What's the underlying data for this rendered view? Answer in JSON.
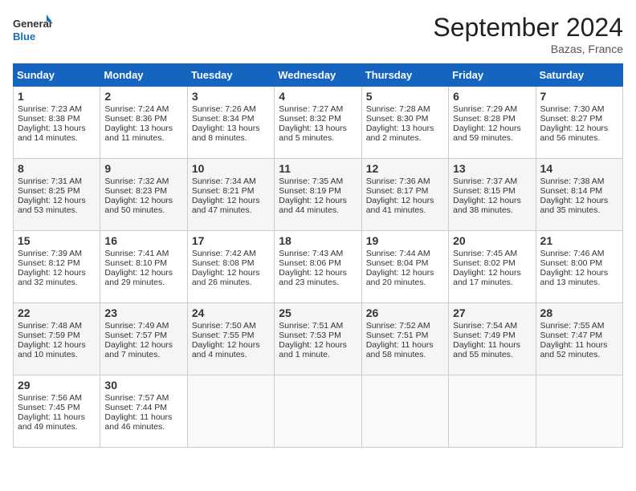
{
  "header": {
    "logo_line1": "General",
    "logo_line2": "Blue",
    "month": "September 2024",
    "location": "Bazas, France"
  },
  "weekdays": [
    "Sunday",
    "Monday",
    "Tuesday",
    "Wednesday",
    "Thursday",
    "Friday",
    "Saturday"
  ],
  "weeks": [
    [
      {
        "day": "1",
        "lines": [
          "Sunrise: 7:23 AM",
          "Sunset: 8:38 PM",
          "Daylight: 13 hours",
          "and 14 minutes."
        ]
      },
      {
        "day": "2",
        "lines": [
          "Sunrise: 7:24 AM",
          "Sunset: 8:36 PM",
          "Daylight: 13 hours",
          "and 11 minutes."
        ]
      },
      {
        "day": "3",
        "lines": [
          "Sunrise: 7:26 AM",
          "Sunset: 8:34 PM",
          "Daylight: 13 hours",
          "and 8 minutes."
        ]
      },
      {
        "day": "4",
        "lines": [
          "Sunrise: 7:27 AM",
          "Sunset: 8:32 PM",
          "Daylight: 13 hours",
          "and 5 minutes."
        ]
      },
      {
        "day": "5",
        "lines": [
          "Sunrise: 7:28 AM",
          "Sunset: 8:30 PM",
          "Daylight: 13 hours",
          "and 2 minutes."
        ]
      },
      {
        "day": "6",
        "lines": [
          "Sunrise: 7:29 AM",
          "Sunset: 8:28 PM",
          "Daylight: 12 hours",
          "and 59 minutes."
        ]
      },
      {
        "day": "7",
        "lines": [
          "Sunrise: 7:30 AM",
          "Sunset: 8:27 PM",
          "Daylight: 12 hours",
          "and 56 minutes."
        ]
      }
    ],
    [
      {
        "day": "8",
        "lines": [
          "Sunrise: 7:31 AM",
          "Sunset: 8:25 PM",
          "Daylight: 12 hours",
          "and 53 minutes."
        ]
      },
      {
        "day": "9",
        "lines": [
          "Sunrise: 7:32 AM",
          "Sunset: 8:23 PM",
          "Daylight: 12 hours",
          "and 50 minutes."
        ]
      },
      {
        "day": "10",
        "lines": [
          "Sunrise: 7:34 AM",
          "Sunset: 8:21 PM",
          "Daylight: 12 hours",
          "and 47 minutes."
        ]
      },
      {
        "day": "11",
        "lines": [
          "Sunrise: 7:35 AM",
          "Sunset: 8:19 PM",
          "Daylight: 12 hours",
          "and 44 minutes."
        ]
      },
      {
        "day": "12",
        "lines": [
          "Sunrise: 7:36 AM",
          "Sunset: 8:17 PM",
          "Daylight: 12 hours",
          "and 41 minutes."
        ]
      },
      {
        "day": "13",
        "lines": [
          "Sunrise: 7:37 AM",
          "Sunset: 8:15 PM",
          "Daylight: 12 hours",
          "and 38 minutes."
        ]
      },
      {
        "day": "14",
        "lines": [
          "Sunrise: 7:38 AM",
          "Sunset: 8:14 PM",
          "Daylight: 12 hours",
          "and 35 minutes."
        ]
      }
    ],
    [
      {
        "day": "15",
        "lines": [
          "Sunrise: 7:39 AM",
          "Sunset: 8:12 PM",
          "Daylight: 12 hours",
          "and 32 minutes."
        ]
      },
      {
        "day": "16",
        "lines": [
          "Sunrise: 7:41 AM",
          "Sunset: 8:10 PM",
          "Daylight: 12 hours",
          "and 29 minutes."
        ]
      },
      {
        "day": "17",
        "lines": [
          "Sunrise: 7:42 AM",
          "Sunset: 8:08 PM",
          "Daylight: 12 hours",
          "and 26 minutes."
        ]
      },
      {
        "day": "18",
        "lines": [
          "Sunrise: 7:43 AM",
          "Sunset: 8:06 PM",
          "Daylight: 12 hours",
          "and 23 minutes."
        ]
      },
      {
        "day": "19",
        "lines": [
          "Sunrise: 7:44 AM",
          "Sunset: 8:04 PM",
          "Daylight: 12 hours",
          "and 20 minutes."
        ]
      },
      {
        "day": "20",
        "lines": [
          "Sunrise: 7:45 AM",
          "Sunset: 8:02 PM",
          "Daylight: 12 hours",
          "and 17 minutes."
        ]
      },
      {
        "day": "21",
        "lines": [
          "Sunrise: 7:46 AM",
          "Sunset: 8:00 PM",
          "Daylight: 12 hours",
          "and 13 minutes."
        ]
      }
    ],
    [
      {
        "day": "22",
        "lines": [
          "Sunrise: 7:48 AM",
          "Sunset: 7:59 PM",
          "Daylight: 12 hours",
          "and 10 minutes."
        ]
      },
      {
        "day": "23",
        "lines": [
          "Sunrise: 7:49 AM",
          "Sunset: 7:57 PM",
          "Daylight: 12 hours",
          "and 7 minutes."
        ]
      },
      {
        "day": "24",
        "lines": [
          "Sunrise: 7:50 AM",
          "Sunset: 7:55 PM",
          "Daylight: 12 hours",
          "and 4 minutes."
        ]
      },
      {
        "day": "25",
        "lines": [
          "Sunrise: 7:51 AM",
          "Sunset: 7:53 PM",
          "Daylight: 12 hours",
          "and 1 minute."
        ]
      },
      {
        "day": "26",
        "lines": [
          "Sunrise: 7:52 AM",
          "Sunset: 7:51 PM",
          "Daylight: 11 hours",
          "and 58 minutes."
        ]
      },
      {
        "day": "27",
        "lines": [
          "Sunrise: 7:54 AM",
          "Sunset: 7:49 PM",
          "Daylight: 11 hours",
          "and 55 minutes."
        ]
      },
      {
        "day": "28",
        "lines": [
          "Sunrise: 7:55 AM",
          "Sunset: 7:47 PM",
          "Daylight: 11 hours",
          "and 52 minutes."
        ]
      }
    ],
    [
      {
        "day": "29",
        "lines": [
          "Sunrise: 7:56 AM",
          "Sunset: 7:45 PM",
          "Daylight: 11 hours",
          "and 49 minutes."
        ]
      },
      {
        "day": "30",
        "lines": [
          "Sunrise: 7:57 AM",
          "Sunset: 7:44 PM",
          "Daylight: 11 hours",
          "and 46 minutes."
        ]
      },
      {
        "day": "",
        "lines": []
      },
      {
        "day": "",
        "lines": []
      },
      {
        "day": "",
        "lines": []
      },
      {
        "day": "",
        "lines": []
      },
      {
        "day": "",
        "lines": []
      }
    ]
  ]
}
